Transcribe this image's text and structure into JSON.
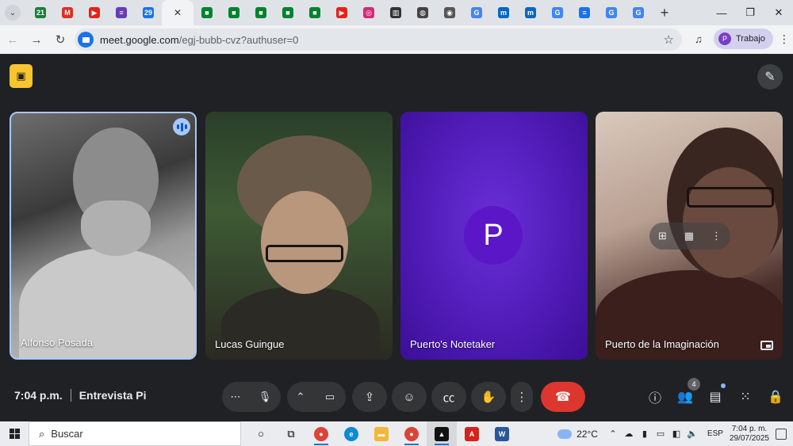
{
  "browser": {
    "tabs": [
      {
        "icon": "chat-icon",
        "text": "21",
        "color": "#188038"
      },
      {
        "icon": "gmail-icon",
        "text": "M",
        "color": "#d93025"
      },
      {
        "icon": "youtube-icon",
        "text": "▶",
        "color": "#e62117"
      },
      {
        "icon": "forms-icon",
        "text": "≡",
        "color": "#673ab7"
      },
      {
        "icon": "calendar-icon",
        "text": "29",
        "color": "#1a73e8"
      },
      {
        "icon": "meet-icon",
        "text": "✕",
        "color": "#f1f3f4",
        "active": true
      },
      {
        "icon": "meet-icon",
        "text": "■",
        "color": "#00832d"
      },
      {
        "icon": "meet-icon",
        "text": "■",
        "color": "#00832d"
      },
      {
        "icon": "meet-icon",
        "text": "■",
        "color": "#00832d"
      },
      {
        "icon": "meet-icon",
        "text": "■",
        "color": "#00832d"
      },
      {
        "icon": "meet-icon",
        "text": "■",
        "color": "#00832d"
      },
      {
        "icon": "youtube-icon",
        "text": "▶",
        "color": "#e62117"
      },
      {
        "icon": "instagram-icon",
        "text": "◎",
        "color": "#d62976"
      },
      {
        "icon": "columns-icon",
        "text": "▥",
        "color": "#333333"
      },
      {
        "icon": "globe-icon",
        "text": "◍",
        "color": "#444444"
      },
      {
        "icon": "chrome-icon",
        "text": "◉",
        "color": "#555555"
      },
      {
        "icon": "google-icon",
        "text": "G",
        "color": "#4285f4"
      },
      {
        "icon": "m-site-icon",
        "text": "m",
        "color": "#0a66c2"
      },
      {
        "icon": "m-site-icon",
        "text": "m",
        "color": "#0a66c2"
      },
      {
        "icon": "google-icon",
        "text": "G",
        "color": "#4285f4"
      },
      {
        "icon": "docs-icon",
        "text": "≡",
        "color": "#1a73e8"
      },
      {
        "icon": "google-icon",
        "text": "G",
        "color": "#4285f4"
      },
      {
        "icon": "google-icon",
        "text": "G",
        "color": "#4285f4"
      }
    ],
    "new_tab": "+",
    "window": {
      "minimize": "—",
      "restore": "❐",
      "close": "✕"
    },
    "url_host": "meet.google.com",
    "url_path": "/egj-bubb-cvz?authuser=0",
    "profile_initial": "P",
    "profile_label": "Trabajo"
  },
  "meeting": {
    "time": "7:04 p.m.",
    "title": "Entrevista Pi",
    "participants": [
      {
        "name": "Alfonso Posada",
        "speaking": true
      },
      {
        "name": "Lucas Guingue"
      },
      {
        "name": "Puerto's Notetaker",
        "avatar_initial": "P"
      },
      {
        "name": "Puerto de la Imaginación"
      }
    ],
    "people_count": "4",
    "accent": "#a8c7fa",
    "hangup_color": "#dc362e"
  },
  "taskbar": {
    "search_placeholder": "Buscar",
    "weather": "22°C",
    "language": "ESP",
    "clock_time": "7:04 p. m.",
    "clock_date": "29/07/2025"
  }
}
